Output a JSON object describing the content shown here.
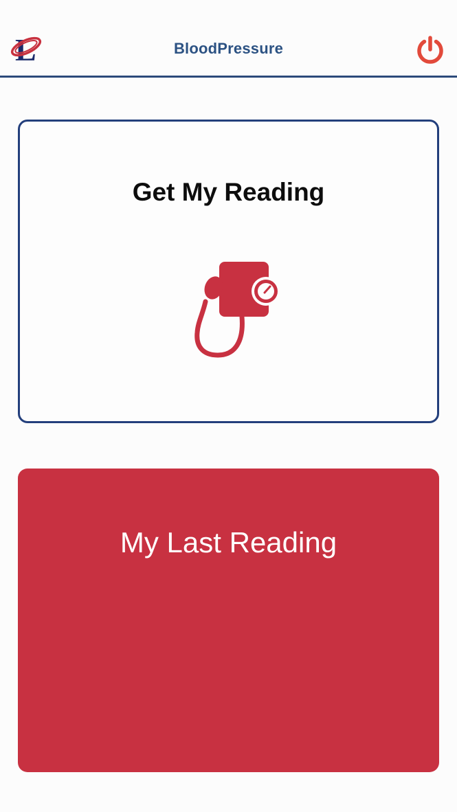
{
  "header": {
    "title": "BloodPressure",
    "logo_icon": "college-logo-icon",
    "power_icon": "power-icon"
  },
  "cards": {
    "get_reading": {
      "label": "Get My Reading",
      "icon": "blood-pressure-cuff-icon"
    },
    "last_reading": {
      "label": "My Last Reading"
    }
  },
  "colors": {
    "header_title": "#2c5283",
    "header_border": "#2c4a7a",
    "card_border": "#233f7c",
    "accent_red": "#c83141",
    "power_icon": "#e24a3b"
  }
}
